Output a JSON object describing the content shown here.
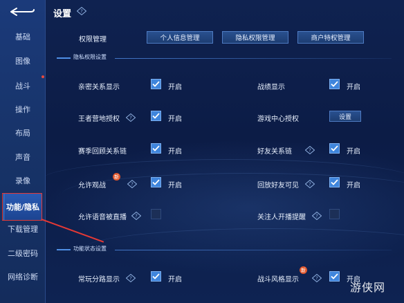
{
  "header": {
    "title": "设置"
  },
  "sidebar": {
    "items": [
      {
        "label": "基础",
        "active": false
      },
      {
        "label": "图像",
        "active": false
      },
      {
        "label": "战斗",
        "active": false
      },
      {
        "label": "操作",
        "active": false
      },
      {
        "label": "布局",
        "active": false
      },
      {
        "label": "声音",
        "active": false
      },
      {
        "label": "录像",
        "active": false
      },
      {
        "label": "功能/隐私",
        "active": true
      },
      {
        "label": "下载管理",
        "active": false
      },
      {
        "label": "二级密码",
        "active": false
      },
      {
        "label": "网络诊断",
        "active": false
      }
    ]
  },
  "permissions": {
    "label": "权限管理",
    "buttons": [
      "个人信息管理",
      "隐私权限管理",
      "商户特权管理"
    ]
  },
  "sections": {
    "privacy": "隐私权限设置",
    "function_status": "功能状态设置"
  },
  "settings": [
    {
      "label": "亲密关系显示",
      "checked": true,
      "state": "开启"
    },
    {
      "label": "战绩显示",
      "checked": true,
      "state": "开启"
    },
    {
      "label": "王者营地授权",
      "checked": true,
      "state": "开启"
    },
    {
      "label": "游戏中心授权",
      "button": "设置"
    },
    {
      "label": "赛季回顾关系链",
      "checked": true,
      "state": "开启"
    },
    {
      "label": "好友关系链",
      "checked": true,
      "state": "开启"
    },
    {
      "label": "允许观战",
      "checked": true,
      "state": "开启",
      "badge": "新"
    },
    {
      "label": "回放好友可见",
      "checked": true,
      "state": "开启"
    },
    {
      "label": "允许语音被直播",
      "checked": false
    },
    {
      "label": "关注人开播提醒",
      "checked": false
    },
    {
      "label": "常玩分路显示",
      "checked": true,
      "state": "开启"
    },
    {
      "label": "战斗风格显示",
      "checked": true,
      "state": "开启",
      "badge": "新"
    }
  ],
  "watermark": "游侠网",
  "colors": {
    "background": "#0c1c46",
    "sidebar": "#173368",
    "active_nav": "#2a5bb4",
    "checkbox_on": "#3f85dc",
    "annotation_red": "#e53935"
  }
}
